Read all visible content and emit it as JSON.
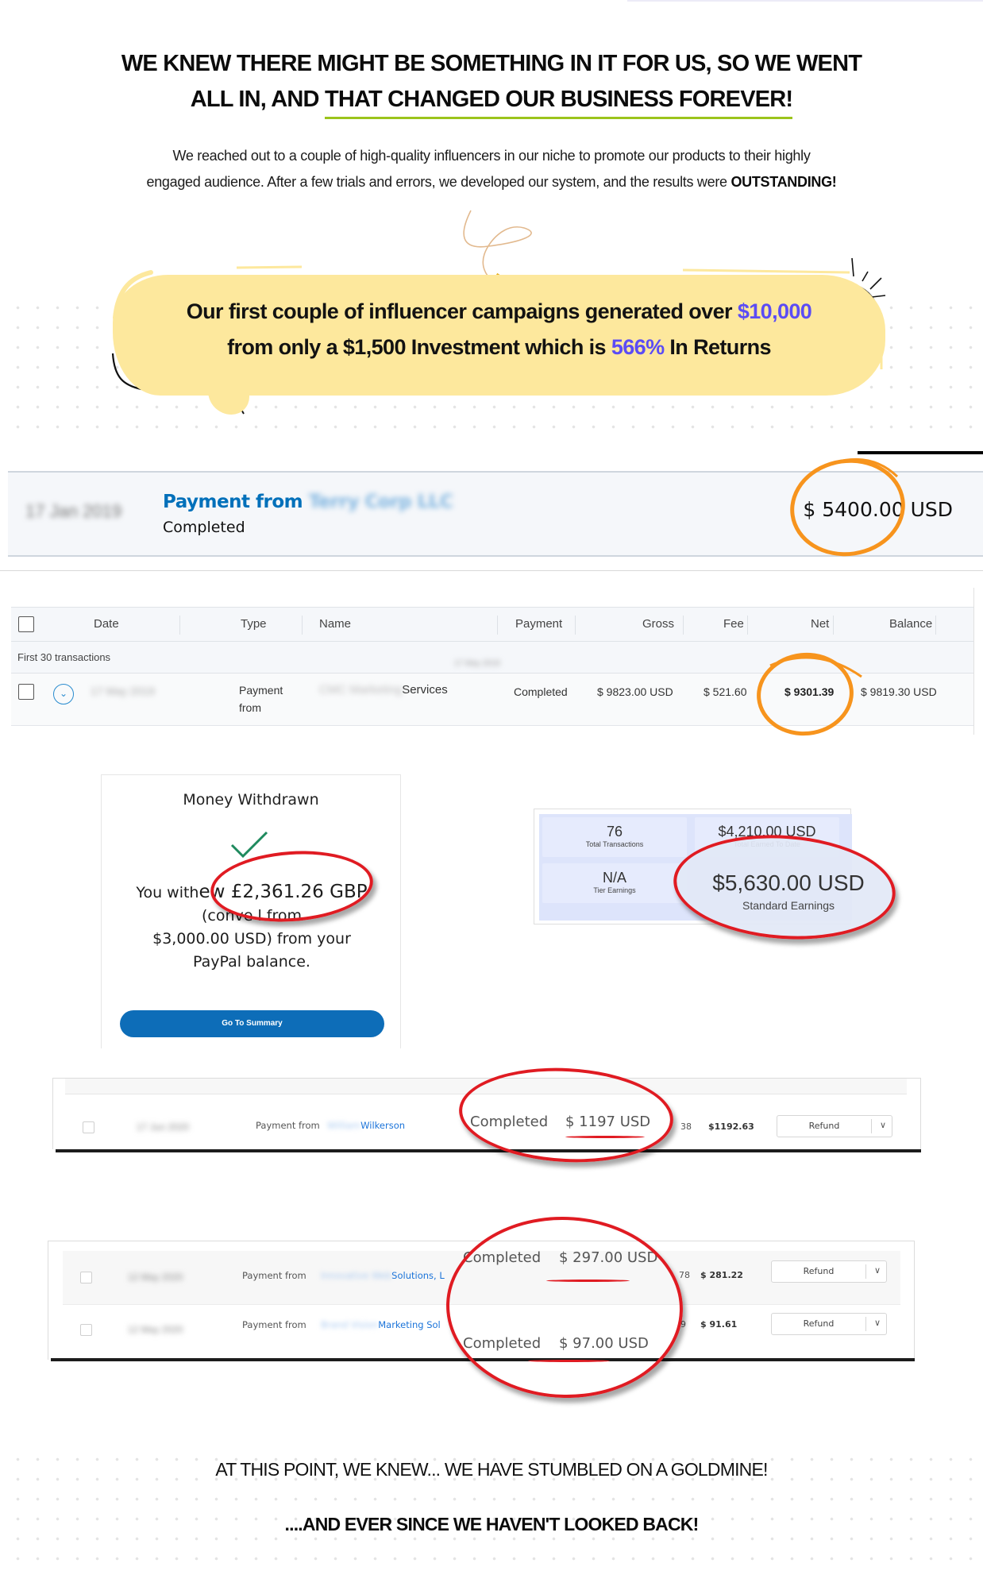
{
  "hero": {
    "headline_line1": "WE KNEW THERE MIGHT BE SOMETHING IN IT FOR US, SO WE WENT",
    "headline_line2_prefix": "ALL IN, AND ",
    "headline_line2_underlined": "THAT CHANGED OUR BUSINESS FOREVER!",
    "intro_line1": "We reached out to a couple of high-quality influencers in our niche to promote our products to their highly",
    "intro_line2": "engaged audience. After a few trials and errors, we developed our system, and the results were ",
    "intro_emphasis": "OUTSTANDING!"
  },
  "bubble": {
    "line1_prefix": "Our first couple of influencer campaigns generated over ",
    "line1_accent": "$10,000",
    "line2_prefix": "from only a $1,500 Investment which is ",
    "line2_accent": "566%",
    "line2_suffix": " In Returns",
    "accent_color": "#5b4cf5",
    "bubble_color": "#fde89d"
  },
  "payment_banner": {
    "date": "17 Jan 2019",
    "title_prefix": "Payment from ",
    "payer": "Terry Corp LLC",
    "status": "Completed",
    "amount": "$ 5400.00 USD"
  },
  "transactions_table": {
    "columns": [
      "Date",
      "Type",
      "Name",
      "Payment",
      "Gross",
      "Fee",
      "Net",
      "Balance"
    ],
    "group_label": "First 30 transactions",
    "group_date": "17 May 2019",
    "row": {
      "date": "17 May 2019",
      "type_line1": "Payment",
      "type_line2": "from",
      "name_blurred": "CMC Marketing",
      "name_visible": "Services",
      "payment": "Completed",
      "gross": "$ 9823.00 USD",
      "fee": "$ 521.60",
      "net": "$ 9301.39",
      "balance": "$ 9819.30 USD"
    }
  },
  "money_withdrawn": {
    "title": "Money Withdrawn",
    "body_line1_prefix": "You with",
    "body_amount": "ew £2,361.26 GBP",
    "body_line2": "(conve   l from",
    "body_line3": "$3,000.00 USD) from your",
    "body_line4": "PayPal balance.",
    "button_label": "Go To Summary",
    "button_color": "#0d6db8"
  },
  "earnings_stats": {
    "tiles": [
      {
        "value": "76",
        "label": "Total Transactions"
      },
      {
        "value": "$4,210.00 USD",
        "label": "Total Earned To Date"
      },
      {
        "value": "N/A",
        "label": "Tier Earnings"
      }
    ],
    "highlight": {
      "value": "$5,630.00 USD",
      "label": "Standard Earnings"
    }
  },
  "strip1": {
    "rows": [
      {
        "date": "17 Jun 2020",
        "type": "Payment from",
        "name_blurred": "William",
        "name_visible": "Wilkerson",
        "status": "Completed",
        "amount": "$ 1197 USD",
        "fee": "38",
        "net": "$1192.63",
        "action": "Refund"
      }
    ]
  },
  "strip2": {
    "rows": [
      {
        "date": "12 May 2020",
        "type": "Payment from",
        "name_blurred": "Innovative Web",
        "name_visible": "Solutions, L",
        "status": "Completed",
        "amount": "$ 297.00 USD",
        "fee": "78",
        "net": "$ 281.22",
        "action": "Refund"
      },
      {
        "date": "12 May 2020",
        "type": "Payment from",
        "name_blurred": "Brand Vision",
        "name_visible": "Marketing Sol",
        "status": "Completed",
        "amount": "$ 97.00 USD",
        "fee": "9",
        "net": "$ 91.61",
        "action": "Refund"
      }
    ]
  },
  "footer": {
    "line1": "AT THIS POINT, WE KNEW... WE HAVE STUMBLED ON A GOLDMINE!",
    "line2": "....AND EVER SINCE WE HAVEN'T LOOKED BACK!"
  },
  "colors": {
    "headline_underline": "#9bc41b",
    "annotation_orange": "#f7941d",
    "annotation_red": "#e01b22",
    "paypal_blue": "#0070ba"
  }
}
